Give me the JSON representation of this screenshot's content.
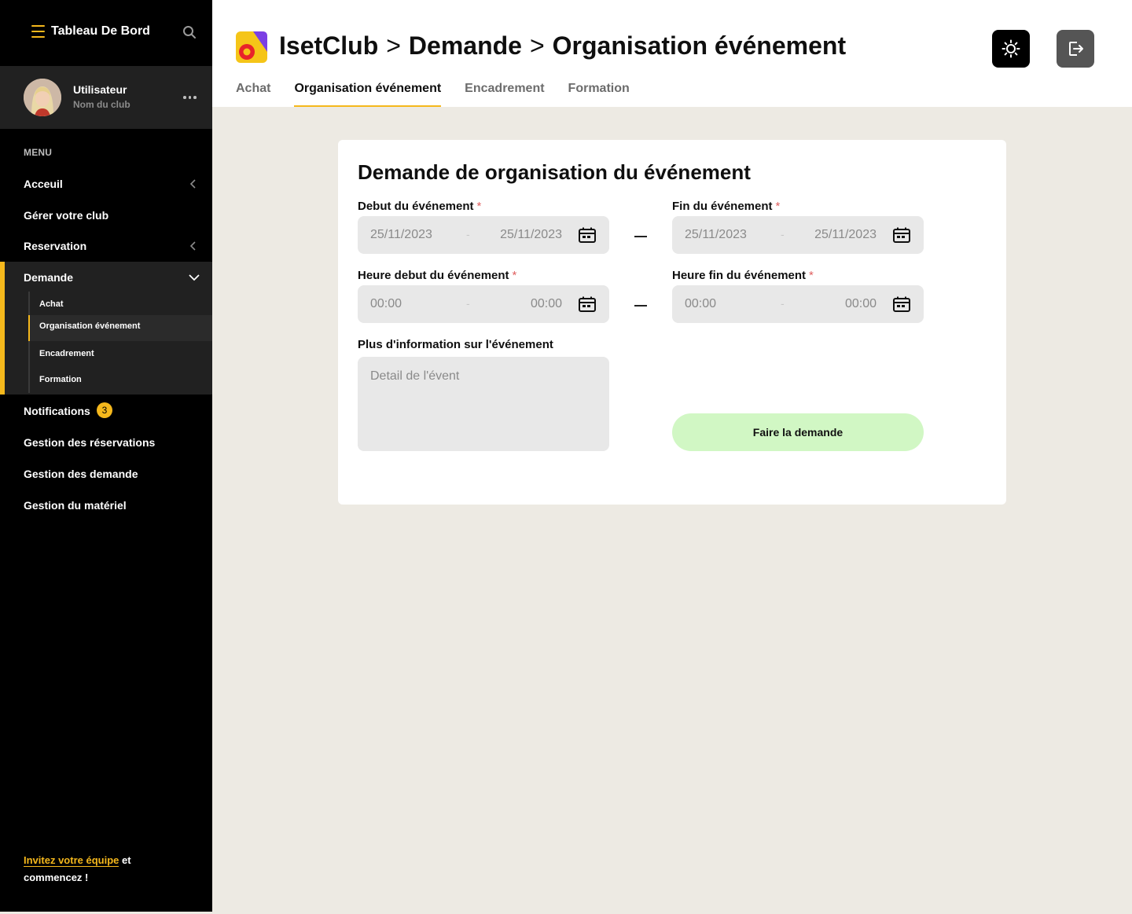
{
  "sidebar": {
    "title": "Tableau De Bord",
    "user": {
      "name": "Utilisateur",
      "club": "Nom du club"
    },
    "menu_label": "MENU",
    "items": {
      "accueil": "Acceuil",
      "gerer": "Gérer votre club",
      "reservation": "Reservation",
      "demande": "Demande",
      "notifications": "Notifications",
      "notifications_count": "3",
      "gestion_reservations": "Gestion des réservations",
      "gestion_demande": "Gestion des demande",
      "gestion_materiel": "Gestion du matériel"
    },
    "demande_sub": [
      "Achat",
      "Organisation événement",
      "Encadrement",
      "Formation"
    ],
    "invite": {
      "link": "Invitez votre équipe",
      "rest": " et commencez !"
    }
  },
  "header": {
    "crumbs": [
      "IsetClub",
      "Demande",
      "Organisation événement"
    ],
    "separator": ">",
    "tabs": [
      "Achat",
      "Organisation événement",
      "Encadrement",
      "Formation"
    ],
    "active_tab": "Organisation événement"
  },
  "form": {
    "title": "Demande de organisation du événement",
    "required_mark": "*",
    "debut_label": "Debut du événement",
    "fin_label": "Fin du événement",
    "heure_debut_label": "Heure debut du événement",
    "heure_fin_label": "Heure fin du événement",
    "range_separator": "-",
    "debut": {
      "start": "25/11/2023",
      "end": "25/11/2023"
    },
    "fin": {
      "start": "25/11/2023",
      "end": "25/11/2023"
    },
    "heure_debut": {
      "start": "00:00",
      "end": "00:00"
    },
    "heure_fin": {
      "start": "00:00",
      "end": "00:00"
    },
    "info_label": "Plus d'information sur l'événement",
    "info_placeholder": "Detail de l'évent",
    "submit_label": "Faire la demande"
  },
  "colors": {
    "accent": "#f5b81c",
    "submit": "#d1f7c4",
    "sidebar": "#000000",
    "page_bg": "#edeae3"
  }
}
